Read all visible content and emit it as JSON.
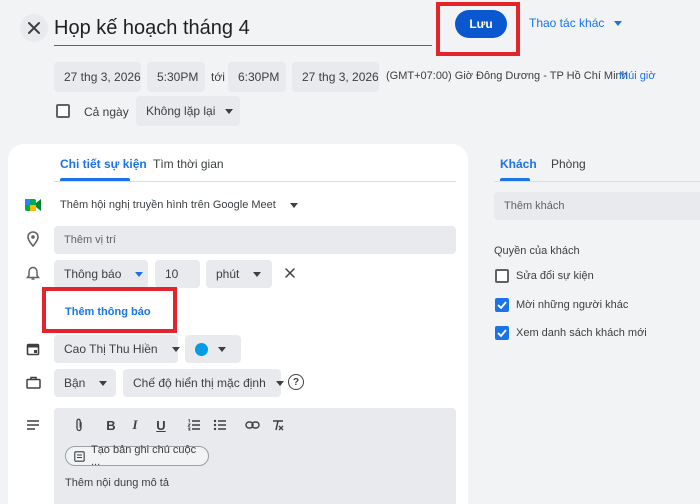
{
  "header": {
    "title": "Họp kế hoạch tháng 4",
    "save_label": "Lưu",
    "more_actions_label": "Thao tác khác"
  },
  "datetime": {
    "start_date": "27 thg 3, 2026",
    "start_time": "5:30PM",
    "to_label": "tới",
    "end_time": "6:30PM",
    "end_date": "27 thg 3, 2026",
    "timezone": "(GMT+07:00) Giờ Đông Dương - TP Hồ Chí Minh",
    "timezone_link": "Múi giờ",
    "all_day_label": "Cả ngày",
    "repeat_label": "Không lặp lại"
  },
  "tabs": {
    "details": "Chi tiết sự kiện",
    "find_time": "Tìm thời gian",
    "guests": "Khách",
    "rooms": "Phòng"
  },
  "details": {
    "meet_label": "Thêm hội nghị truyền hình trên Google Meet",
    "location_placeholder": "Thêm vị trí",
    "notification_type": "Thông báo",
    "notification_value": "10",
    "notification_unit": "phút",
    "add_notification": "Thêm thông báo",
    "calendar_owner": "Cao Thị Thu Hiền",
    "calendar_color": "#039be5",
    "busy_status": "Bận",
    "visibility": "Chế độ hiển thị mặc định",
    "notes_chip": "Tạo bản ghi chú cuộc ...",
    "description_placeholder": "Thêm nội dung mô tả"
  },
  "guests": {
    "add_guests_placeholder": "Thêm khách",
    "permissions_title": "Quyền của khách",
    "permissions": [
      {
        "label": "Sửa đổi sự kiện",
        "checked": false
      },
      {
        "label": "Mời những người khác",
        "checked": true
      },
      {
        "label": "Xem danh sách khách mới",
        "checked": true
      }
    ]
  },
  "colors": {
    "accent": "#1a73e8",
    "highlight": "#e3242b"
  }
}
